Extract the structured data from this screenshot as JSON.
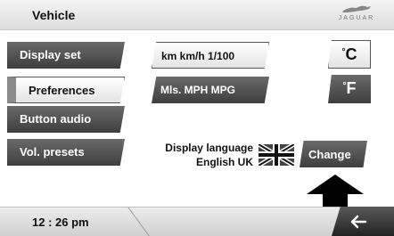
{
  "header": {
    "title": "Vehicle",
    "brand": "JAGUAR"
  },
  "menu": [
    {
      "label": "Display set"
    },
    {
      "label": "Preferences"
    },
    {
      "label": "Button audio"
    },
    {
      "label": "Vol. presets"
    }
  ],
  "units": {
    "metric": "km km/h 1/100",
    "imperial": "Mls. MPH MPG",
    "celsius_degree": "°",
    "celsius_letter": "C",
    "fahrenheit_degree": "°",
    "fahrenheit_letter": "F"
  },
  "language": {
    "label_line1": "Display language",
    "label_line2": "English UK",
    "change_label": "Change"
  },
  "footer": {
    "time": "12 : 26 pm"
  }
}
